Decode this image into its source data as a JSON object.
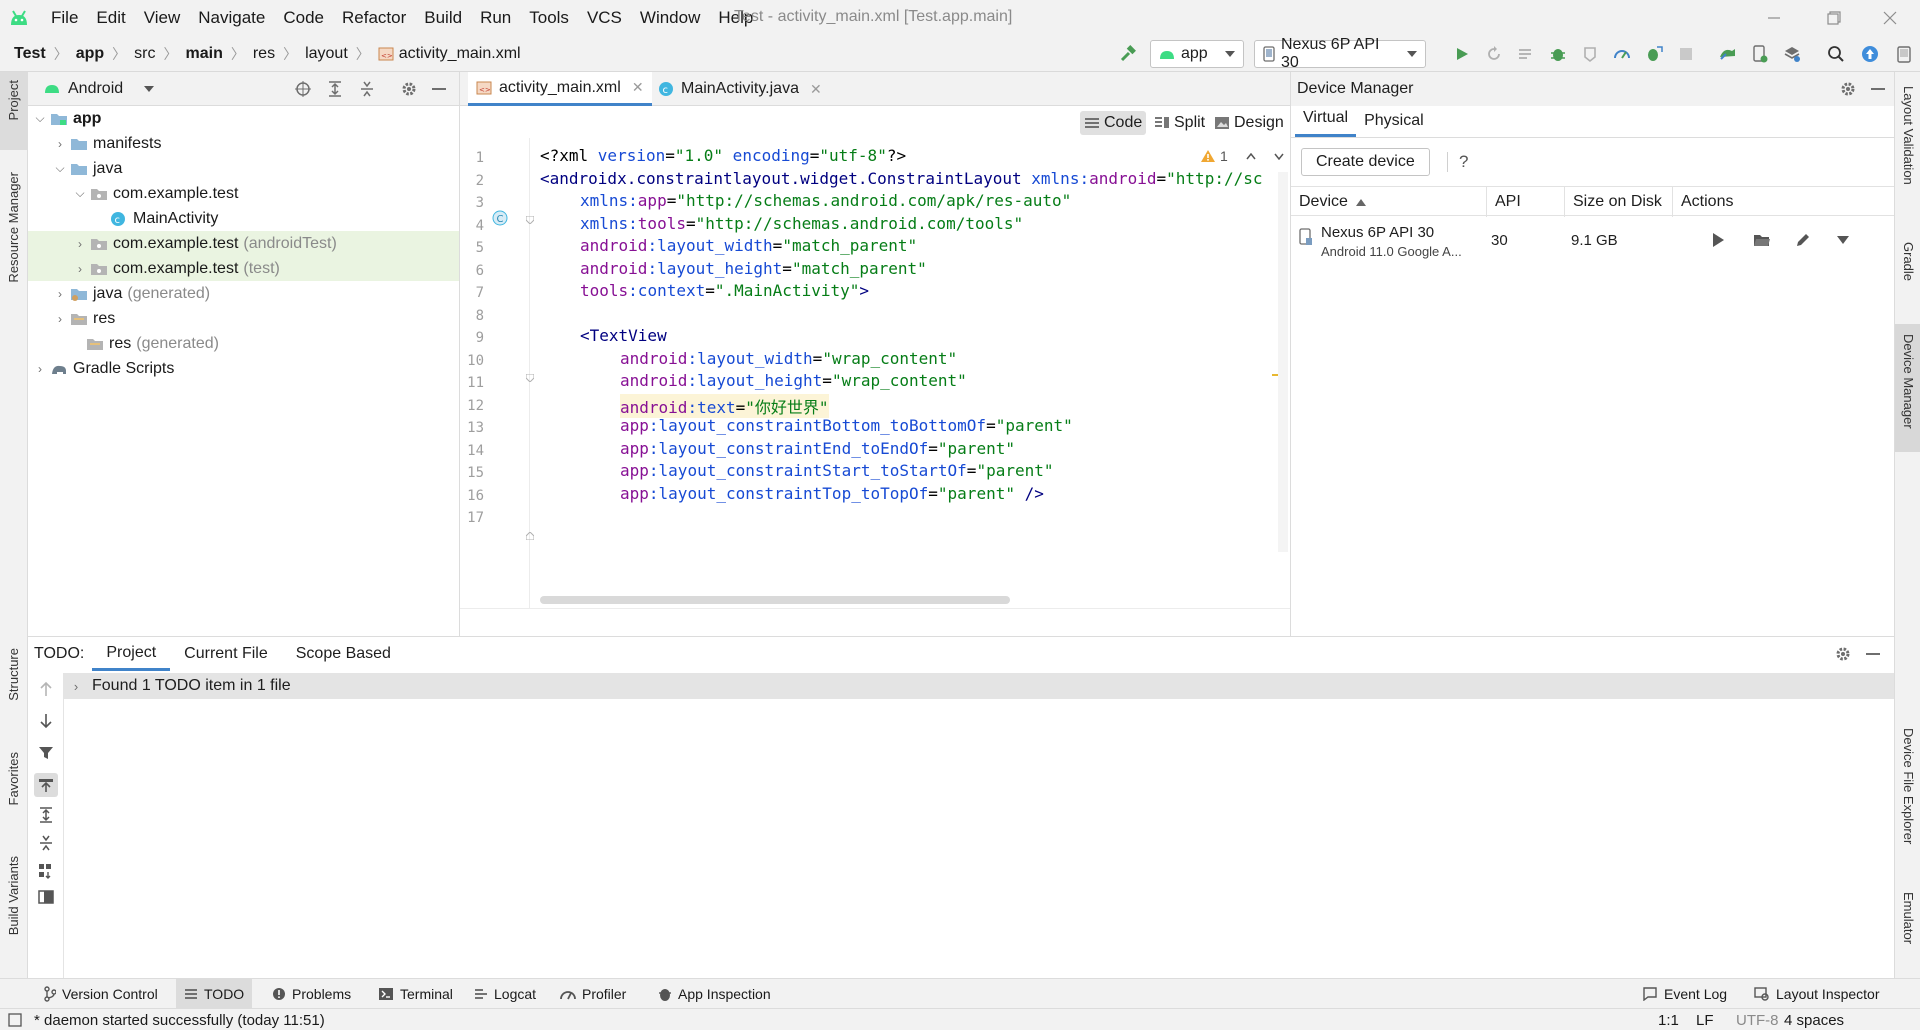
{
  "menubar": {
    "items": [
      "File",
      "Edit",
      "View",
      "Navigate",
      "Code",
      "Refactor",
      "Build",
      "Run",
      "Tools",
      "VCS",
      "Window",
      "Help"
    ],
    "window_title": "Test - activity_main.xml [Test.app.main]"
  },
  "navbar": {
    "breadcrumbs": [
      "Test",
      "app",
      "src",
      "main",
      "res",
      "layout",
      "activity_main.xml"
    ],
    "run_config": "app",
    "device": "Nexus 6P API 30"
  },
  "project_panel": {
    "view_mode": "Android",
    "tree": [
      {
        "label": "app",
        "suffix": ""
      },
      {
        "label": "manifests",
        "suffix": ""
      },
      {
        "label": "java",
        "suffix": ""
      },
      {
        "label": "com.example.test",
        "suffix": ""
      },
      {
        "label": "MainActivity",
        "suffix": ""
      },
      {
        "label": "com.example.test",
        "suffix": "(androidTest)"
      },
      {
        "label": "com.example.test",
        "suffix": "(test)"
      },
      {
        "label": "java",
        "suffix": "(generated)"
      },
      {
        "label": "res",
        "suffix": ""
      },
      {
        "label": "res",
        "suffix": "(generated)"
      },
      {
        "label": "Gradle Scripts",
        "suffix": ""
      }
    ]
  },
  "editor": {
    "tabs": [
      {
        "label": "activity_main.xml",
        "active": true
      },
      {
        "label": "MainActivity.java",
        "active": false
      }
    ],
    "modes": [
      "Code",
      "Split",
      "Design"
    ],
    "warning_count": "1",
    "line_numbers": [
      "1",
      "2",
      "3",
      "4",
      "5",
      "6",
      "7",
      "8",
      "9",
      "10",
      "11",
      "12",
      "13",
      "14",
      "15",
      "16",
      "17"
    ],
    "code": {
      "l1a": "<?xml ",
      "l1b": "version",
      "l1c": "=",
      "l1d": "\"1.0\"",
      "l1e": " encoding",
      "l1f": "=",
      "l1g": "\"utf-8\"",
      "l1h": "?>",
      "l2a": "<androidx.constraintlayout.widget.ConstraintLayout ",
      "l2b": "xmlns:",
      "l2c": "android",
      "l2d": "=",
      "l2e": "\"http://sc",
      "l3a": "xmlns:",
      "l3b": "app",
      "l3c": "=",
      "l3d": "\"http://schemas.android.com/apk/res-auto\"",
      "l4a": "xmlns:",
      "l4b": "tools",
      "l4c": "=",
      "l4d": "\"http://schemas.android.com/tools\"",
      "l5a": "android",
      "l5b": ":layout_width",
      "l5c": "=",
      "l5d": "\"match_parent\"",
      "l6a": "android",
      "l6b": ":layout_height",
      "l6c": "=",
      "l6d": "\"match_parent\"",
      "l7a": "tools",
      "l7b": ":context",
      "l7c": "=",
      "l7d": "\".MainActivity\"",
      "l7e": ">",
      "l9a": "<TextView",
      "l10a": "android",
      "l10b": ":layout_width",
      "l10c": "=",
      "l10d": "\"wrap_content\"",
      "l11a": "android",
      "l11b": ":layout_height",
      "l11c": "=",
      "l11d": "\"wrap_content\"",
      "l12a": "android",
      "l12b": ":text",
      "l12c": "=",
      "l12d": "\"你好世界\"",
      "l13a": "app",
      "l13b": ":layout_constraintBottom_toBottomOf",
      "l13c": "=",
      "l13d": "\"parent\"",
      "l14a": "app",
      "l14b": ":layout_constraintEnd_toEndOf",
      "l14c": "=",
      "l14d": "\"parent\"",
      "l15a": "app",
      "l15b": ":layout_constraintStart_toStartOf",
      "l15c": "=",
      "l15d": "\"parent\"",
      "l16a": "app",
      "l16b": ":layout_constraintTop_toTopOf",
      "l16c": "=",
      "l16d": "\"parent\"",
      "l16e": " />"
    }
  },
  "device_manager": {
    "title": "Device Manager",
    "tabs": [
      "Virtual",
      "Physical"
    ],
    "create_button": "Create device",
    "help": "?",
    "columns": [
      "Device",
      "API",
      "Size on Disk",
      "Actions"
    ],
    "devices": [
      {
        "name": "Nexus 6P API 30",
        "detail": "Android 11.0 Google A...",
        "api": "30",
        "size": "9.1 GB"
      }
    ]
  },
  "todo_panel": {
    "label": "TODO:",
    "tabs": [
      "Project",
      "Current File",
      "Scope Based"
    ],
    "result": "Found 1 TODO item in 1 file"
  },
  "left_strip": [
    "Project",
    "Resource Manager",
    "Structure",
    "Favorites",
    "Build Variants"
  ],
  "right_strip": [
    "Layout Validation",
    "Gradle",
    "Device Manager",
    "Device File Explorer",
    "Emulator"
  ],
  "bottom_tools": [
    "Version Control",
    "TODO",
    "Problems",
    "Terminal",
    "Logcat",
    "Profiler",
    "App Inspection",
    "Event Log",
    "Layout Inspector"
  ],
  "status": {
    "message": "* daemon started successfully (today 11:51)",
    "position": "1:1",
    "line_sep": "LF",
    "encoding": "UTF-8",
    "indent": "4 spaces"
  },
  "colors": {
    "accent": "#4083c9",
    "android_green": "#3ddc84",
    "run_green": "#499c54",
    "xml_tag": "#000080",
    "xml_attr": "#174ad4",
    "xml_string": "#067d17",
    "xml_ns": "#871094"
  }
}
